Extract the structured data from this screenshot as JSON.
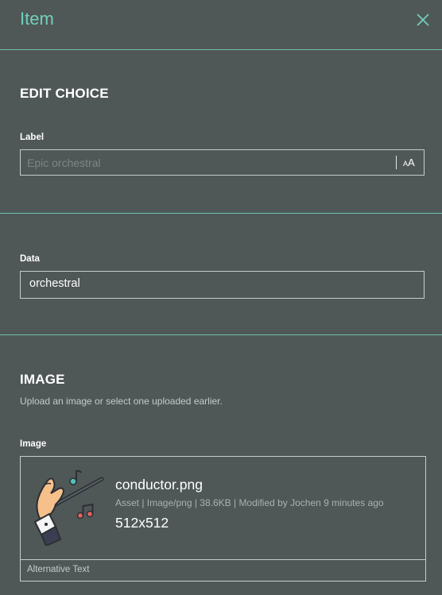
{
  "panel": {
    "title": "Item"
  },
  "edit_choice": {
    "heading": "EDIT CHOICE",
    "label_field": {
      "label": "Label",
      "placeholder": "Epic orchestral",
      "font_toggle": {
        "small": "A",
        "large": "A"
      }
    }
  },
  "data_section": {
    "data_field": {
      "label": "Data",
      "value": "orchestral"
    }
  },
  "image_section": {
    "heading": "IMAGE",
    "helper": "Upload an image or select one uploaded earlier.",
    "image_label": "Image",
    "file": {
      "name": "conductor.png",
      "meta": "Asset | Image/png | 38.6KB | Modified by Jochen 9 minutes ago",
      "dimensions": "512x512",
      "alt_text_label": "Alternative Text"
    }
  },
  "colors": {
    "background": "#505757",
    "accent": "#6fd1bc",
    "divider": "#6fc3b0"
  }
}
